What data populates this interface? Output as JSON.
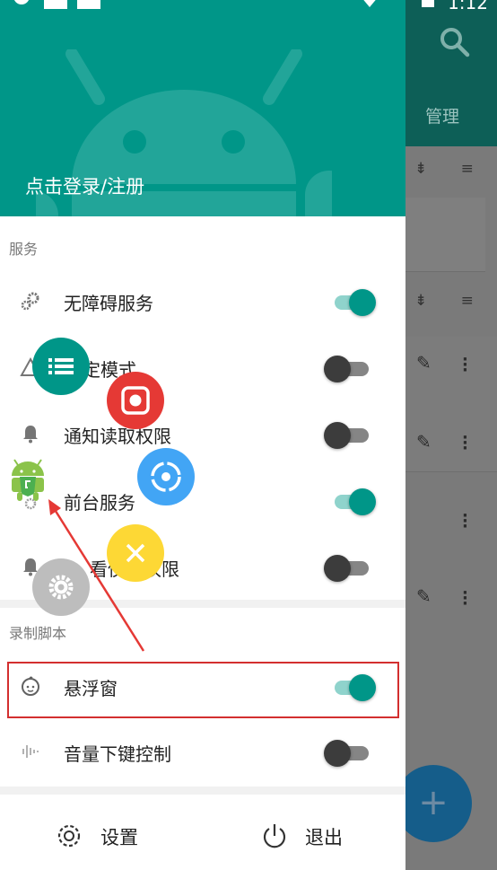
{
  "background_app": {
    "manage_tab_label": "管理",
    "fab_symbol": "+"
  },
  "status_bar": {
    "time": "1:12"
  },
  "drawer": {
    "header": {
      "login_text": "点击登录/注册",
      "color": "#009688"
    },
    "sections": [
      {
        "title": "服务",
        "items": [
          {
            "label": "无障碍服务",
            "icon": "gears-icon",
            "enabled": true
          },
          {
            "label": "定模式",
            "icon": "warning-icon",
            "enabled": false
          },
          {
            "label": "通知读取权限",
            "icon": "bell-icon",
            "enabled": false
          },
          {
            "label": "前台服务",
            "icon": "service-icon",
            "enabled": true
          },
          {
            "label": "看使计权限",
            "icon": "bell-icon",
            "enabled": false
          }
        ]
      },
      {
        "title": "录制脚本",
        "items": [
          {
            "label": "悬浮窗",
            "icon": "baby-face-icon",
            "enabled": true,
            "highlighted": true
          },
          {
            "label": "音量下键控制",
            "icon": "waveform-icon",
            "enabled": false
          }
        ]
      }
    ],
    "footer": {
      "settings_label": "设置",
      "exit_label": "退出"
    }
  },
  "floating_menu": {
    "buttons": [
      {
        "name": "list",
        "color": "#009688"
      },
      {
        "name": "record",
        "color": "#e53935"
      },
      {
        "name": "target",
        "color": "#42a5f5"
      },
      {
        "name": "close",
        "color": "#fdd835"
      },
      {
        "name": "settings",
        "color": "#bdbdbd"
      }
    ]
  },
  "accent": "#009688",
  "annotation_color": "#d32f2f"
}
